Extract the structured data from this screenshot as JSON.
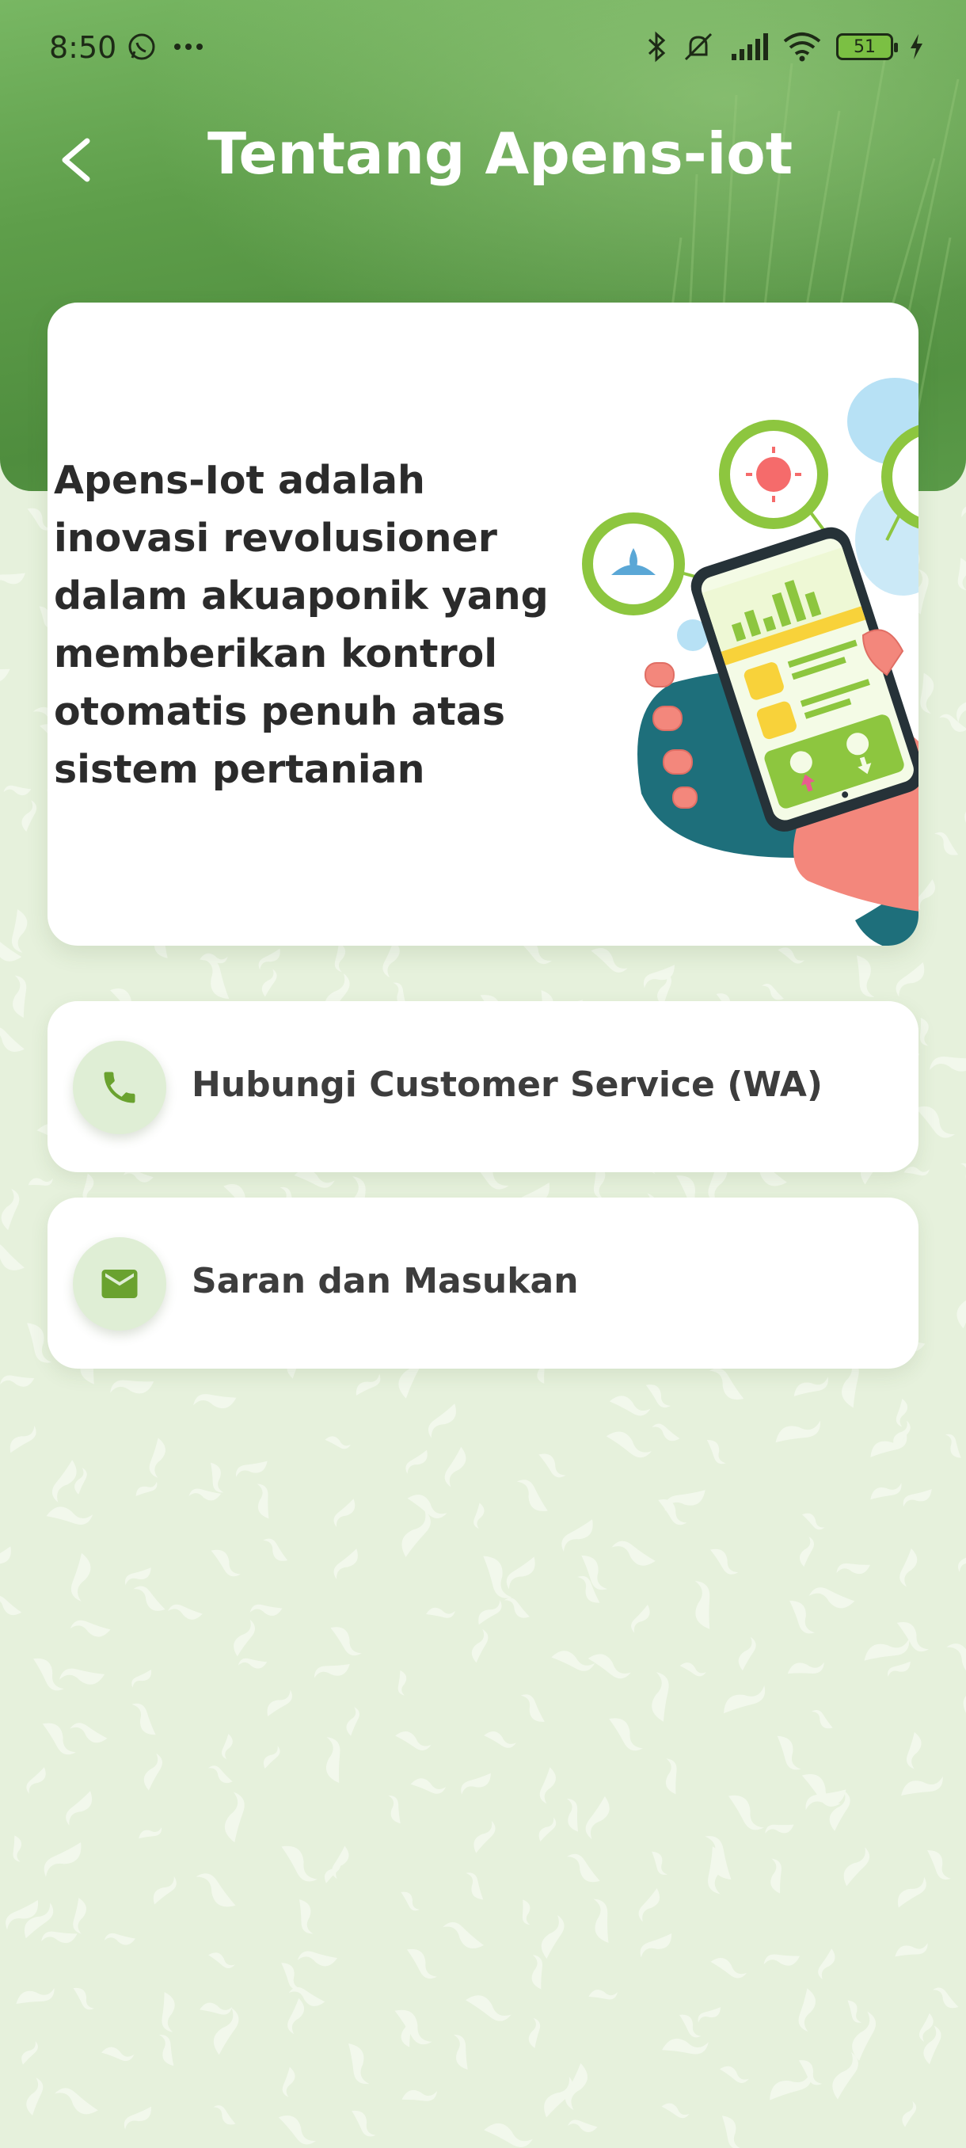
{
  "status_bar": {
    "time": "8:50",
    "icons": [
      "whatsapp-icon",
      "more-dots-icon",
      "bluetooth-icon",
      "mute-icon",
      "signal-icon",
      "wifi-icon",
      "battery-icon",
      "charging-icon"
    ],
    "battery_level": "51"
  },
  "header": {
    "title": "Tentang Apens-iot",
    "back_icon": "chevron-left-icon"
  },
  "info_card": {
    "description": "Apens-Iot adalah inovasi revolusioner dalam akuaponik yang memberikan kontrol otomatis penuh atas sistem pertanian"
  },
  "actions": [
    {
      "label": "Hubungi Customer Service (WA)",
      "icon": "phone-icon"
    },
    {
      "label": "Saran dan Masukan",
      "icon": "mail-icon"
    }
  ],
  "colors": {
    "primary_green": "#6aa84f",
    "accent_green": "#7cb342",
    "background": "#e6f1dc",
    "card": "#ffffff"
  }
}
